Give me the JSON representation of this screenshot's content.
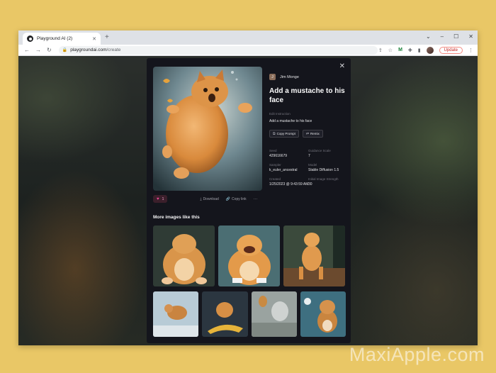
{
  "browser": {
    "tab_title": "Playground AI (2)",
    "new_tab": "+",
    "url_host": "playgroundai.com",
    "url_path": "/create",
    "update_label": "Update"
  },
  "modal": {
    "author_initial": "J",
    "author_name": "Jim Monge",
    "prompt_title": "Add a mustache to his face",
    "edit_instruction_label": "Edit Instruction",
    "edit_instruction_value": "Add a mustache to his face",
    "copy_prompt_label": "Copy Prompt",
    "remix_label": "Remix",
    "meta": [
      {
        "label": "Seed",
        "value": "429616679"
      },
      {
        "label": "Guidance Scale",
        "value": "7"
      },
      {
        "label": "Sampler",
        "value": "k_euler_ancestral"
      },
      {
        "label": "Model",
        "value": "Stable Diffusion 1.5"
      },
      {
        "label": "Created",
        "value": "1/25/2023 @ 9:43:59 AM"
      },
      {
        "label": "Initial Image Strength",
        "value": "30"
      }
    ],
    "likes": "1",
    "download_label": "Download",
    "copy_link_label": "Copy link",
    "more_label": "···",
    "more_images_heading": "More images like this"
  },
  "watermark": "MaxiApple.com"
}
